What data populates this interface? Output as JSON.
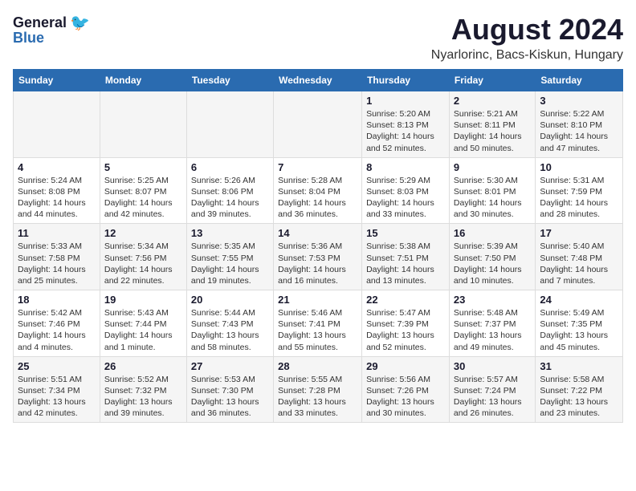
{
  "header": {
    "logo_general": "General",
    "logo_blue": "Blue",
    "title": "August 2024",
    "subtitle": "Nyarlorinc, Bacs-Kiskun, Hungary"
  },
  "weekdays": [
    "Sunday",
    "Monday",
    "Tuesday",
    "Wednesday",
    "Thursday",
    "Friday",
    "Saturday"
  ],
  "weeks": [
    [
      {
        "day": "",
        "detail": ""
      },
      {
        "day": "",
        "detail": ""
      },
      {
        "day": "",
        "detail": ""
      },
      {
        "day": "",
        "detail": ""
      },
      {
        "day": "1",
        "detail": "Sunrise: 5:20 AM\nSunset: 8:13 PM\nDaylight: 14 hours\nand 52 minutes."
      },
      {
        "day": "2",
        "detail": "Sunrise: 5:21 AM\nSunset: 8:11 PM\nDaylight: 14 hours\nand 50 minutes."
      },
      {
        "day": "3",
        "detail": "Sunrise: 5:22 AM\nSunset: 8:10 PM\nDaylight: 14 hours\nand 47 minutes."
      }
    ],
    [
      {
        "day": "4",
        "detail": "Sunrise: 5:24 AM\nSunset: 8:08 PM\nDaylight: 14 hours\nand 44 minutes."
      },
      {
        "day": "5",
        "detail": "Sunrise: 5:25 AM\nSunset: 8:07 PM\nDaylight: 14 hours\nand 42 minutes."
      },
      {
        "day": "6",
        "detail": "Sunrise: 5:26 AM\nSunset: 8:06 PM\nDaylight: 14 hours\nand 39 minutes."
      },
      {
        "day": "7",
        "detail": "Sunrise: 5:28 AM\nSunset: 8:04 PM\nDaylight: 14 hours\nand 36 minutes."
      },
      {
        "day": "8",
        "detail": "Sunrise: 5:29 AM\nSunset: 8:03 PM\nDaylight: 14 hours\nand 33 minutes."
      },
      {
        "day": "9",
        "detail": "Sunrise: 5:30 AM\nSunset: 8:01 PM\nDaylight: 14 hours\nand 30 minutes."
      },
      {
        "day": "10",
        "detail": "Sunrise: 5:31 AM\nSunset: 7:59 PM\nDaylight: 14 hours\nand 28 minutes."
      }
    ],
    [
      {
        "day": "11",
        "detail": "Sunrise: 5:33 AM\nSunset: 7:58 PM\nDaylight: 14 hours\nand 25 minutes."
      },
      {
        "day": "12",
        "detail": "Sunrise: 5:34 AM\nSunset: 7:56 PM\nDaylight: 14 hours\nand 22 minutes."
      },
      {
        "day": "13",
        "detail": "Sunrise: 5:35 AM\nSunset: 7:55 PM\nDaylight: 14 hours\nand 19 minutes."
      },
      {
        "day": "14",
        "detail": "Sunrise: 5:36 AM\nSunset: 7:53 PM\nDaylight: 14 hours\nand 16 minutes."
      },
      {
        "day": "15",
        "detail": "Sunrise: 5:38 AM\nSunset: 7:51 PM\nDaylight: 14 hours\nand 13 minutes."
      },
      {
        "day": "16",
        "detail": "Sunrise: 5:39 AM\nSunset: 7:50 PM\nDaylight: 14 hours\nand 10 minutes."
      },
      {
        "day": "17",
        "detail": "Sunrise: 5:40 AM\nSunset: 7:48 PM\nDaylight: 14 hours\nand 7 minutes."
      }
    ],
    [
      {
        "day": "18",
        "detail": "Sunrise: 5:42 AM\nSunset: 7:46 PM\nDaylight: 14 hours\nand 4 minutes."
      },
      {
        "day": "19",
        "detail": "Sunrise: 5:43 AM\nSunset: 7:44 PM\nDaylight: 14 hours\nand 1 minute."
      },
      {
        "day": "20",
        "detail": "Sunrise: 5:44 AM\nSunset: 7:43 PM\nDaylight: 13 hours\nand 58 minutes."
      },
      {
        "day": "21",
        "detail": "Sunrise: 5:46 AM\nSunset: 7:41 PM\nDaylight: 13 hours\nand 55 minutes."
      },
      {
        "day": "22",
        "detail": "Sunrise: 5:47 AM\nSunset: 7:39 PM\nDaylight: 13 hours\nand 52 minutes."
      },
      {
        "day": "23",
        "detail": "Sunrise: 5:48 AM\nSunset: 7:37 PM\nDaylight: 13 hours\nand 49 minutes."
      },
      {
        "day": "24",
        "detail": "Sunrise: 5:49 AM\nSunset: 7:35 PM\nDaylight: 13 hours\nand 45 minutes."
      }
    ],
    [
      {
        "day": "25",
        "detail": "Sunrise: 5:51 AM\nSunset: 7:34 PM\nDaylight: 13 hours\nand 42 minutes."
      },
      {
        "day": "26",
        "detail": "Sunrise: 5:52 AM\nSunset: 7:32 PM\nDaylight: 13 hours\nand 39 minutes."
      },
      {
        "day": "27",
        "detail": "Sunrise: 5:53 AM\nSunset: 7:30 PM\nDaylight: 13 hours\nand 36 minutes."
      },
      {
        "day": "28",
        "detail": "Sunrise: 5:55 AM\nSunset: 7:28 PM\nDaylight: 13 hours\nand 33 minutes."
      },
      {
        "day": "29",
        "detail": "Sunrise: 5:56 AM\nSunset: 7:26 PM\nDaylight: 13 hours\nand 30 minutes."
      },
      {
        "day": "30",
        "detail": "Sunrise: 5:57 AM\nSunset: 7:24 PM\nDaylight: 13 hours\nand 26 minutes."
      },
      {
        "day": "31",
        "detail": "Sunrise: 5:58 AM\nSunset: 7:22 PM\nDaylight: 13 hours\nand 23 minutes."
      }
    ]
  ]
}
